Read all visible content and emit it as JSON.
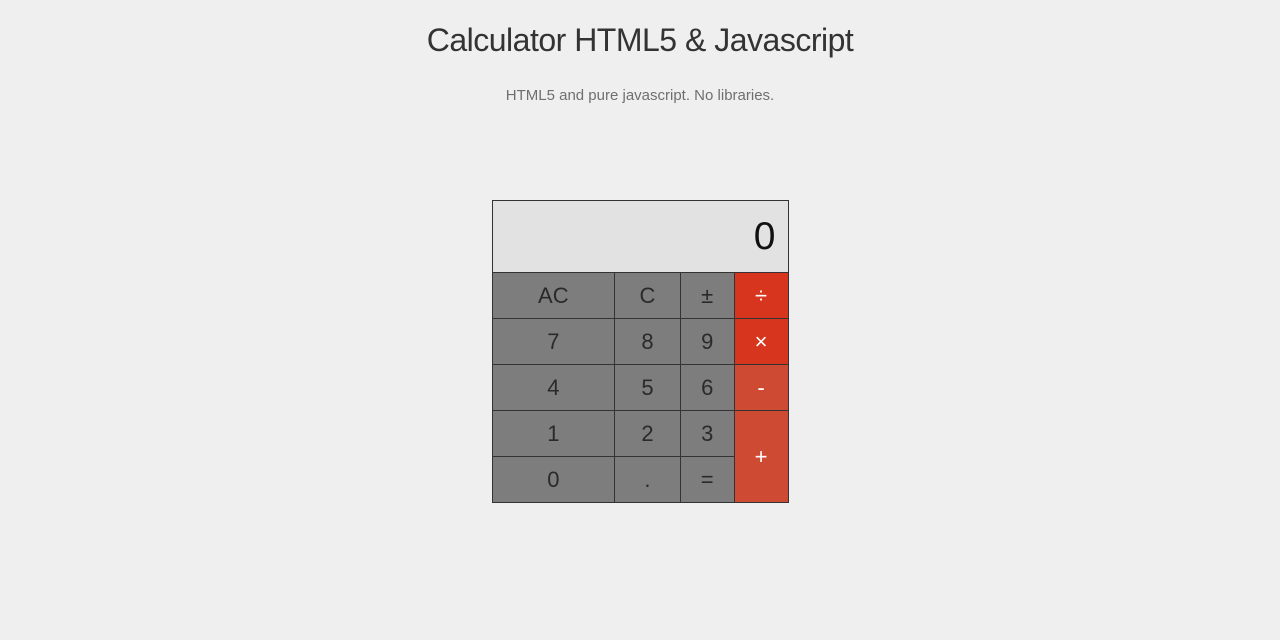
{
  "header": {
    "title": "Calculator HTML5 & Javascript",
    "subtitle": "HTML5 and pure javascript. No libraries."
  },
  "calc": {
    "display": "0",
    "buttons": {
      "ac": "AC",
      "c": "C",
      "plus_minus": "±",
      "divide": "÷",
      "multiply": "×",
      "minus": "-",
      "plus": "+",
      "equals": "=",
      "dot": ".",
      "d0": "0",
      "d1": "1",
      "d2": "2",
      "d3": "3",
      "d4": "4",
      "d5": "5",
      "d6": "6",
      "d7": "7",
      "d8": "8",
      "d9": "9"
    }
  }
}
